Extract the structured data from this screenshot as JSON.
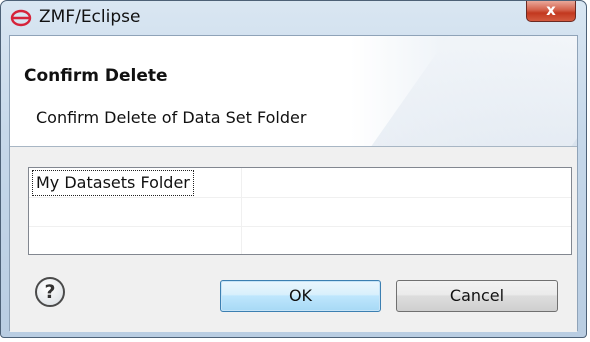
{
  "window": {
    "title": "ZMF/Eclipse",
    "close_symbol": "x",
    "app_icon": "zmf-logo-icon"
  },
  "banner": {
    "title": "Confirm Delete",
    "message": "Confirm Delete of Data Set Folder"
  },
  "table": {
    "rows": [
      {
        "name": "My Datasets Folder",
        "value": ""
      },
      {
        "name": "",
        "value": ""
      },
      {
        "name": "",
        "value": ""
      }
    ]
  },
  "buttons": {
    "help_icon": "help-icon",
    "help_symbol": "?",
    "ok_label": "OK",
    "cancel_label": "Cancel"
  },
  "colors": {
    "titlebar": "#c6d8ea",
    "close_button": "#c2381f",
    "default_button_border": "#3c7fb1"
  }
}
